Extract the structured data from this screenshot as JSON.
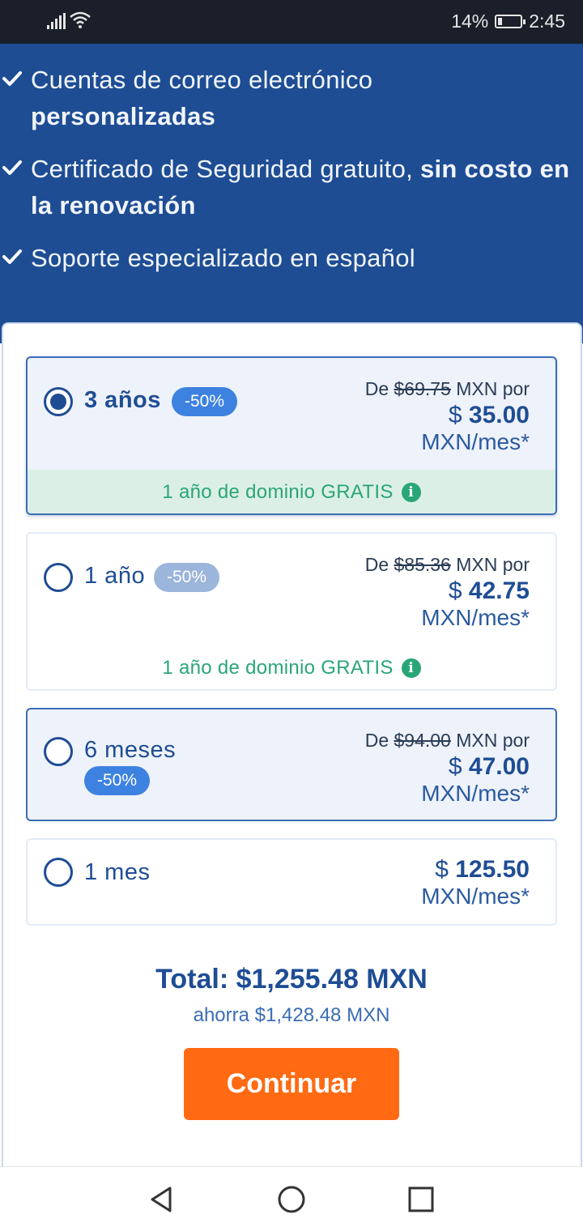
{
  "status_bar": {
    "battery": "14%",
    "time": "2:45"
  },
  "features": [
    {
      "normal": "Cuentas de correo electrónico ",
      "bold": "personalizadas"
    },
    {
      "normal": "Certificado de Seguridad gratuito, ",
      "bold": "sin costo en la renovación"
    },
    {
      "normal": "Soporte especializado en español",
      "bold": ""
    }
  ],
  "plans": [
    {
      "label": "3 años",
      "badge": "-50%",
      "from_prefix": "De ",
      "original_price": "$69.75",
      "from_suffix": " MXN por",
      "currency": "$ ",
      "price": "35.00",
      "unit": "MXN/mes*",
      "promo": "1 año de dominio GRATIS",
      "selected": true
    },
    {
      "label": "1 año",
      "badge": "-50%",
      "from_prefix": "De ",
      "original_price": "$85.36",
      "from_suffix": " MXN por",
      "currency": "$ ",
      "price": "42.75",
      "unit": "MXN/mes*",
      "promo": "1 año de dominio GRATIS",
      "selected": false
    },
    {
      "label": "6 meses",
      "badge": "-50%",
      "from_prefix": "De ",
      "original_price": "$94.00",
      "from_suffix": " MXN por",
      "currency": "$ ",
      "price": "47.00",
      "unit": "MXN/mes*",
      "selected": false
    },
    {
      "label": "1 mes",
      "currency": "$ ",
      "price": "125.50",
      "unit": "MXN/mes*",
      "selected": false
    }
  ],
  "summary": {
    "total": "Total: $1,255.48 MXN",
    "savings": "ahorra $1,428.48 MXN",
    "button": "Continuar"
  },
  "colors": {
    "brand_blue": "#1e4d94",
    "accent_orange": "#ff6a13",
    "promo_green": "#2aa676",
    "badge_blue": "#3d82e0"
  }
}
